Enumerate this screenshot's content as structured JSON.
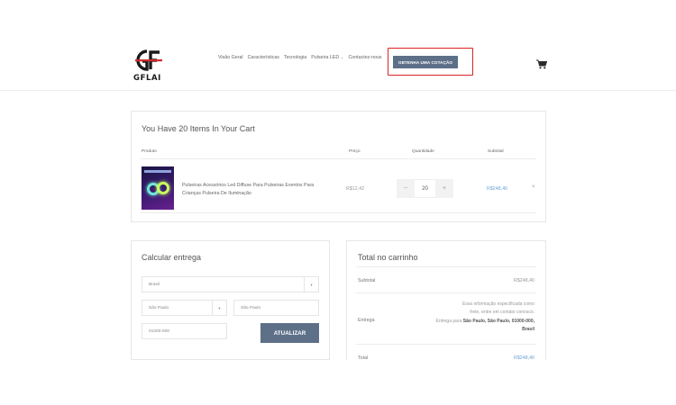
{
  "brand": {
    "logo_text": "GFLAI"
  },
  "nav": {
    "items": [
      {
        "label": "Visão Geral"
      },
      {
        "label": "Características"
      },
      {
        "label": "Tecnologia"
      },
      {
        "label": "Pulseira LED"
      },
      {
        "label": "Contactez-nous"
      }
    ],
    "quote_button": "OBTENHA UMA COTAÇÃO",
    "dropdown_icon": "chevron-down-icon",
    "cart_icon": "shopping-cart-icon"
  },
  "cart": {
    "title": "You Have 20 Items In Your Cart",
    "columns": [
      "Produto",
      "Preço",
      "Quantidade",
      "Subtotal"
    ],
    "items": [
      {
        "name": "Pulseiras Acessórios Led Diffuse Para Pulseiras Eventos Para Crianças Pulseira De Iluminação",
        "price": "R$12,42",
        "quantity": "20",
        "subtotal": "R$248,40",
        "decrement": "−",
        "increment": "+",
        "remove": "×"
      }
    ]
  },
  "shipping": {
    "title": "Calcular entrega",
    "country": "Brasil",
    "state": "São Paulo",
    "city_placeholder": "São Paulo",
    "postcode_placeholder": "01000-000",
    "update_button": "ATUALIZAR"
  },
  "totals": {
    "title": "Total no carrinho",
    "subtotal_label": "Subtotal",
    "subtotal_value": "R$248,40",
    "shipping_label": "Entrega",
    "shipping_note_1": "Essa informação especificada como",
    "shipping_note_2": "frete, entre em contato conosco.",
    "shipping_to_prefix": "Entrega para ",
    "shipping_to_address": "São Paulo, São Paulo, 01000-000, Brasil",
    "total_label": "Total",
    "total_value": "R$248,40"
  },
  "colors": {
    "accent": "#5d7088",
    "highlight": "#dd2222",
    "link": "#6aa0d8"
  }
}
